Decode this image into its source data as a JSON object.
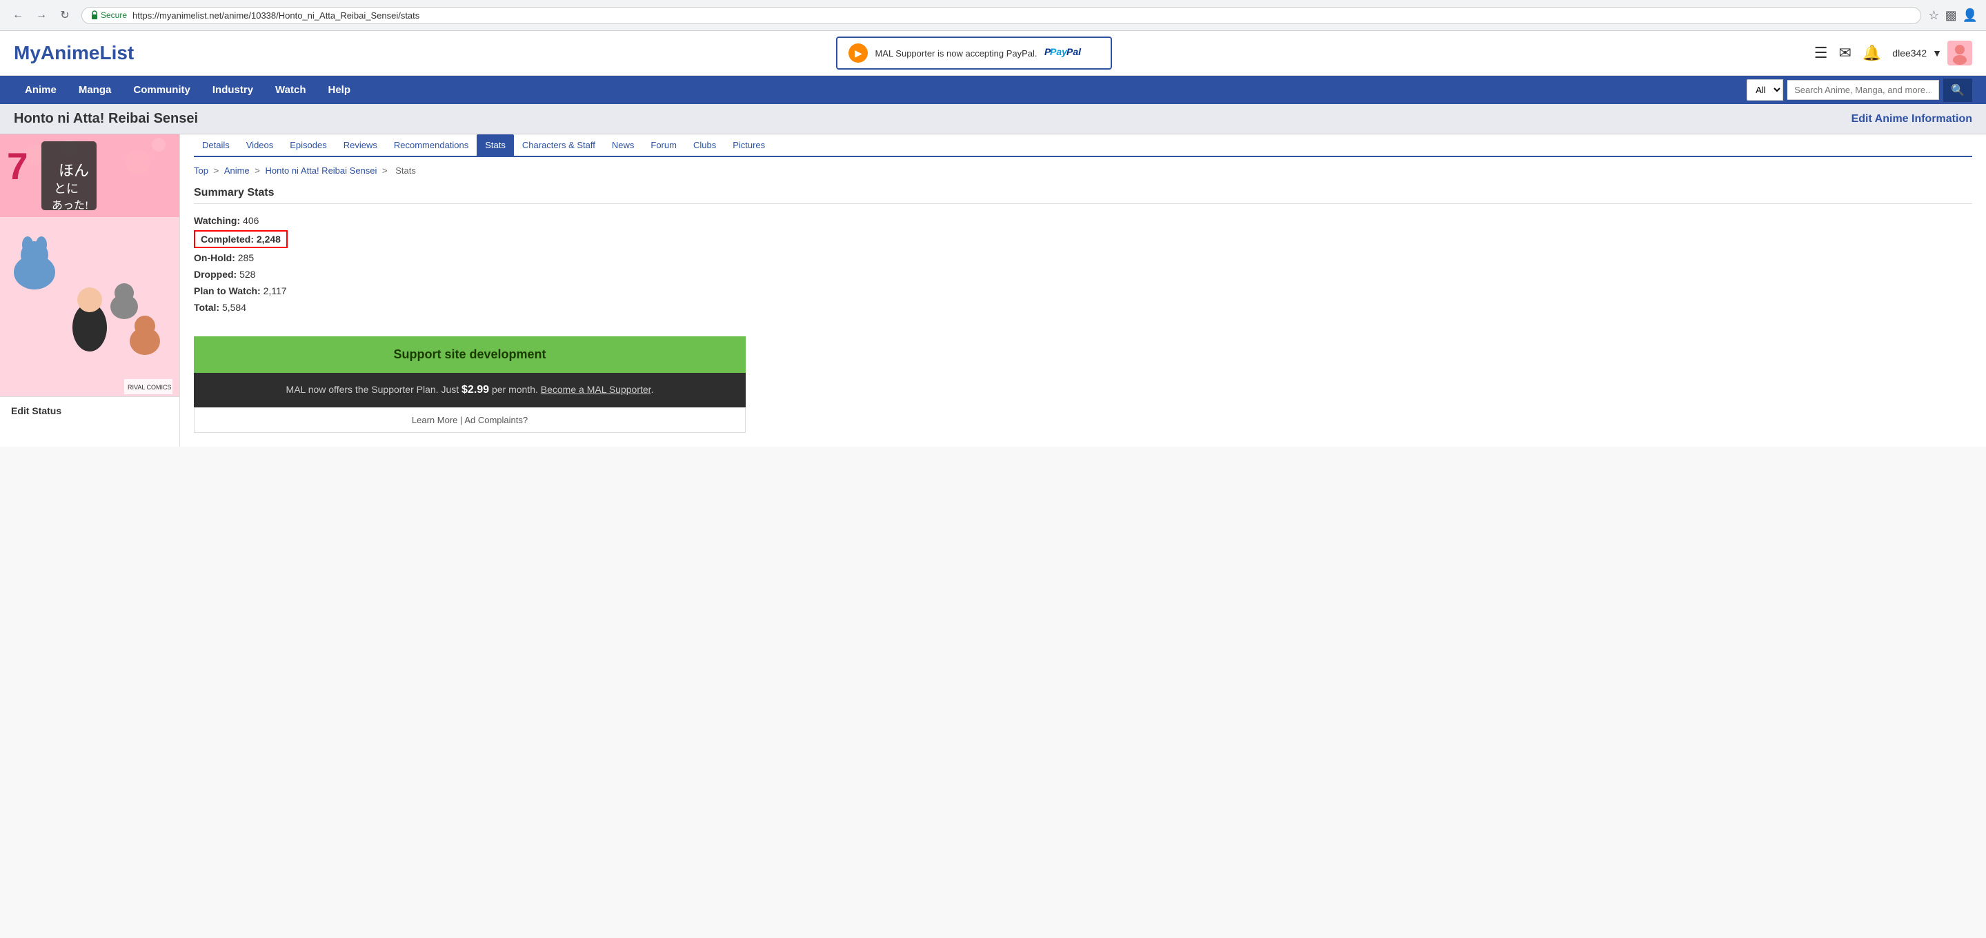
{
  "browser": {
    "url": "https://myanimelist.net/anime/10338/Honto_ni_Atta_Reibai_Sensei/stats",
    "secure_text": "Secure"
  },
  "header": {
    "logo": "MyAnimeList",
    "paypal_banner_text": "MAL Supporter is now accepting PayPal.",
    "paypal_label": "PayPal",
    "username": "dlee342"
  },
  "nav": {
    "links": [
      "Anime",
      "Manga",
      "Community",
      "Industry",
      "Watch",
      "Help"
    ],
    "search_placeholder": "Search Anime, Manga, and more...",
    "search_option": "All"
  },
  "page": {
    "title": "Honto ni Atta! Reibai Sensei",
    "edit_link": "Edit Anime Information"
  },
  "sub_nav": {
    "tabs": [
      "Details",
      "Videos",
      "Episodes",
      "Reviews",
      "Recommendations",
      "Stats",
      "Characters & Staff",
      "News",
      "Forum",
      "Clubs",
      "Pictures"
    ],
    "active": "Stats"
  },
  "breadcrumb": {
    "items": [
      "Top",
      "Anime",
      "Honto ni Atta! Reibai Sensei",
      "Stats"
    ]
  },
  "stats": {
    "title": "Summary Stats",
    "items": [
      {
        "label": "Watching",
        "value": "406",
        "highlighted": false
      },
      {
        "label": "Completed",
        "value": "2,248",
        "highlighted": true
      },
      {
        "label": "On-Hold",
        "value": "285",
        "highlighted": false
      },
      {
        "label": "Dropped",
        "value": "528",
        "highlighted": false
      },
      {
        "label": "Plan to Watch",
        "value": "2,117",
        "highlighted": false
      },
      {
        "label": "Total",
        "value": "5,584",
        "highlighted": false
      }
    ]
  },
  "support": {
    "header": "Support site development",
    "body_text": "MAL now offers the Supporter Plan. Just ",
    "price": "$2.99",
    "body_suffix": " per month. ",
    "become_link": "Become a MAL Supporter",
    "body_end": ".",
    "footer_learn": "Learn More",
    "footer_sep": "|",
    "footer_ad": "Ad Complaints?"
  },
  "edit_status": {
    "title": "Edit Status"
  }
}
